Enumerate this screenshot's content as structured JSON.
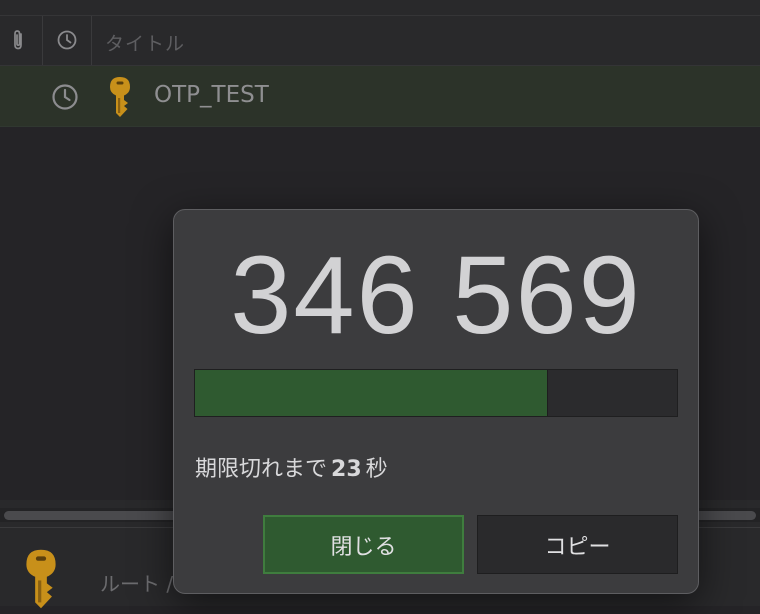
{
  "list": {
    "headers": {
      "attachment_icon": "paperclip-icon",
      "modified_icon": "clock-icon",
      "title_label": "タイトル"
    },
    "entries": [
      {
        "title": "OTP_TEST",
        "icon": "key-icon",
        "status_icon": "clock-icon"
      }
    ]
  },
  "details": {
    "icon": "key-icon",
    "group_label": "ルート /"
  },
  "otp_dialog": {
    "code": "346 569",
    "progress_fraction": 0.73,
    "expiry_prefix": "期限切れまで",
    "expiry_seconds": "23",
    "expiry_unit": "秒",
    "close_button": "閉じる",
    "copy_button": "コピー"
  },
  "colors": {
    "accent_green": "#2f5a30",
    "key_gold": "#c8901a"
  }
}
